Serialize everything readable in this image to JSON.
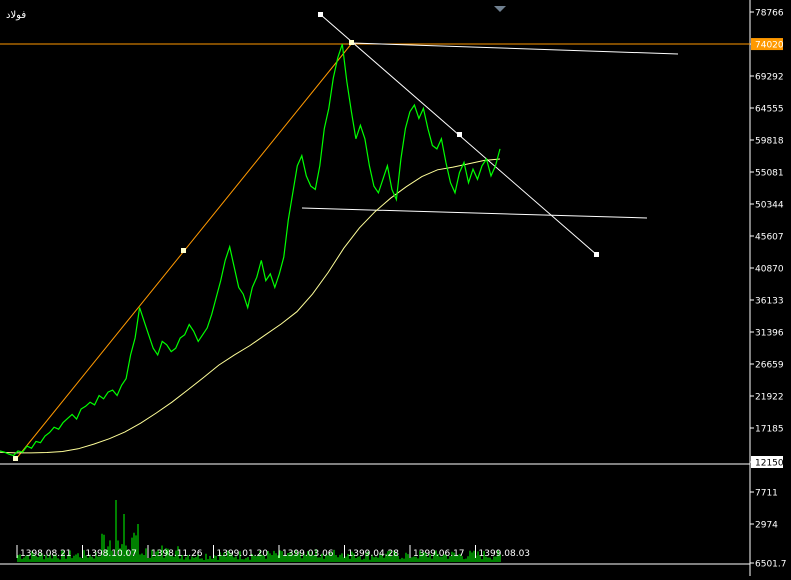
{
  "symbol": "فولاد",
  "colors": {
    "background": "#000000",
    "price": "#00ff00",
    "moving_average": "#ffff99",
    "axis": "#ffffff",
    "orange_line": "#ff9900",
    "white_line": "#ffffff",
    "current_label_bg": "#ff9900",
    "last_price_label_bg": "#ffffff"
  },
  "chart_data": {
    "type": "line",
    "title": "",
    "price_axis": {
      "ticks": [
        "78766",
        "74020",
        "69292",
        "64555",
        "59818",
        "55081",
        "50344",
        "45607",
        "40870",
        "36133",
        "31396",
        "26659",
        "21922",
        "17185",
        "12150"
      ],
      "range": [
        12150,
        78766
      ],
      "highlight_label": "74020",
      "last_label": "12150"
    },
    "volume_axis": {
      "ticks": [
        "7711",
        "2974",
        "6501.7"
      ],
      "range": [
        6501.7,
        8500
      ]
    },
    "time_labels": [
      "1398.08.21",
      "1398.10.07",
      "1398.11.26",
      "1399.01.20",
      "1399.03.06",
      "1399.04.28",
      "1399.06.17",
      "1399.08.03"
    ],
    "series": [
      {
        "values": [
          13800,
          13600,
          13300,
          13100,
          13800,
          13600,
          14500,
          14200,
          15200,
          15000,
          16000,
          16500,
          17300,
          17000,
          18000,
          18600,
          19200,
          18500,
          20000,
          20400,
          21000,
          20600,
          22000,
          21500,
          22500,
          22800,
          22000,
          23500,
          24500,
          28000,
          30500,
          35000,
          33000,
          31000,
          29000,
          28000,
          30000,
          29500,
          28500,
          29000,
          30500,
          31000,
          32500,
          31500,
          30000,
          31000,
          32000,
          34000,
          36500,
          39000,
          42000,
          44000,
          41000,
          38000,
          37000,
          35000,
          38000,
          39500,
          42000,
          39000,
          40000,
          38000,
          40000,
          42500,
          48000,
          52000,
          56000,
          57500,
          54500,
          53000,
          52500,
          56000,
          61500,
          64500,
          69000,
          72000,
          74000,
          68500,
          64000,
          60000,
          62000,
          60000,
          56000,
          53000,
          52000,
          54000,
          56000,
          52500,
          51000,
          57000,
          61500,
          64000,
          65000,
          63000,
          64500,
          61500,
          59000,
          58500,
          60000,
          56500,
          53500,
          52000,
          55000,
          56500,
          53500,
          55500,
          54000,
          56000,
          57000,
          54500,
          56000,
          58500
        ]
      },
      {
        "values": [
          13600,
          13500,
          13500,
          13550,
          13700,
          14100,
          14800,
          15600,
          16600,
          17900,
          19400,
          21000,
          22800,
          24600,
          26500,
          28000,
          29400,
          31000,
          32600,
          34400,
          37000,
          40200,
          43800,
          46800,
          49200,
          51200,
          52900,
          54400,
          55400,
          55800,
          56300,
          56800,
          57000
        ]
      }
    ]
  }
}
